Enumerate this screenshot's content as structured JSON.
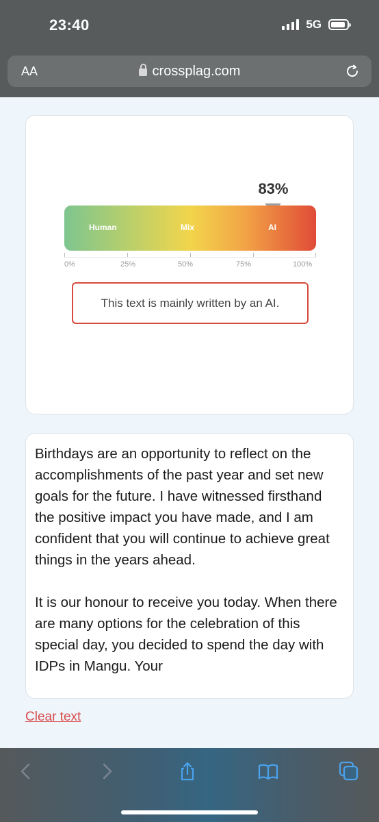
{
  "status": {
    "time": "23:40",
    "network": "5G"
  },
  "browser": {
    "text_size_label": "AA",
    "url": "crossplag.com"
  },
  "result": {
    "percent_label": "83%",
    "ai_fraction": 0.83,
    "zones": [
      "Human",
      "Mix",
      "AI"
    ],
    "ticks": [
      "0%",
      "25%",
      "50%",
      "75%",
      "100%"
    ],
    "verdict": "This text is mainly written by an AI.",
    "colors": {
      "human": "#7ec58f",
      "mix": "#f2d54b",
      "ai": "#e04b37",
      "verdict_border": "#d64a3f"
    }
  },
  "input_text": {
    "paragraph_1": "Birthdays are an opportunity to reflect on the accomplishments of the past year and set new goals for the future. I have witnessed firsthand the positive impact you have made, and I am confident that you will continue to achieve great things in the years ahead.",
    "paragraph_2": "It is our honour to receive you today. When there are many options for the celebration of this special day, you decided to spend the day with IDPs in Mangu. Your"
  },
  "actions": {
    "clear_label": "Clear text"
  },
  "toolbar": {
    "icons": [
      "back-icon",
      "forward-icon",
      "share-icon",
      "bookmarks-icon",
      "tabs-icon"
    ]
  }
}
